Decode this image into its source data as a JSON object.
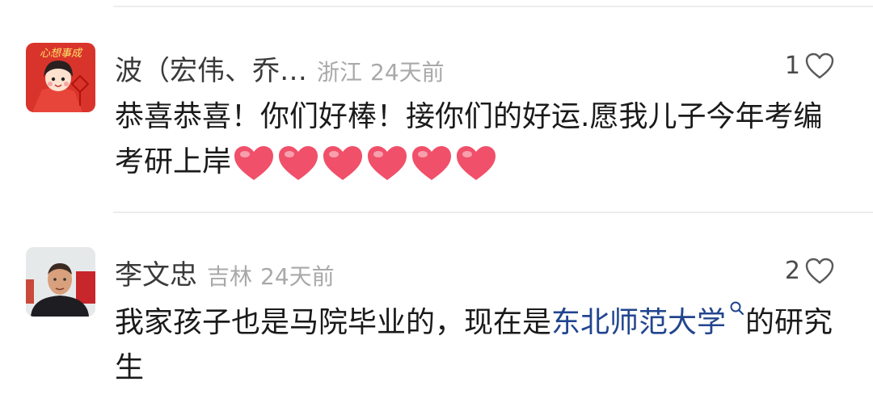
{
  "comments": [
    {
      "name": "波（宏伟、乔…",
      "location": "浙江",
      "time": "24天前",
      "likes": "1",
      "avatar_text": "心想事成",
      "avatar_icon": "cartoon-girl-avatar",
      "text": "恭喜恭喜！你们好棒！接你们的好运.愿我儿子今年考编考研上岸",
      "heart_count": 6
    },
    {
      "name": "李文忠",
      "location": "吉林",
      "time": "24天前",
      "likes": "2",
      "avatar_icon": "man-photo-avatar",
      "text_before": "我家孩子也是马院毕业的，现在是",
      "link_text": "东北师范大学",
      "text_after": "的研究生"
    }
  ],
  "colors": {
    "link": "#21458f",
    "heart": "#f0506a",
    "muted": "#a9a9a9"
  }
}
